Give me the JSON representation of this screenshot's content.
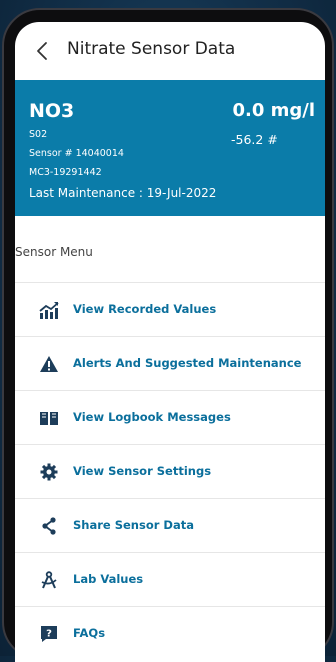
{
  "header": {
    "title": "Nitrate Sensor Data"
  },
  "sensor": {
    "name": "NO3",
    "code": "S02",
    "serial": "Sensor # 14040014",
    "model": "MC3-19291442",
    "last_maintenance": "Last Maintenance : 19-Jul-2022",
    "reading": "0.0 mg/l",
    "raw_value": "-56.2 #"
  },
  "menu": {
    "caption": "Sensor Menu",
    "items": [
      {
        "label": "View Recorded Values",
        "icon": "chart-line-icon"
      },
      {
        "label": "Alerts And Suggested Maintenance",
        "icon": "warning-icon"
      },
      {
        "label": "View Logbook Messages",
        "icon": "book-open-icon"
      },
      {
        "label": "View Sensor Settings",
        "icon": "gear-icon"
      },
      {
        "label": "Share Sensor Data",
        "icon": "share-icon"
      },
      {
        "label": "Lab Values",
        "icon": "compass-icon"
      },
      {
        "label": "FAQs",
        "icon": "question-icon"
      }
    ]
  },
  "colors": {
    "accent": "#0b7ca9",
    "menu_text": "#0b6f9c",
    "icon": "#1d3d5a"
  }
}
